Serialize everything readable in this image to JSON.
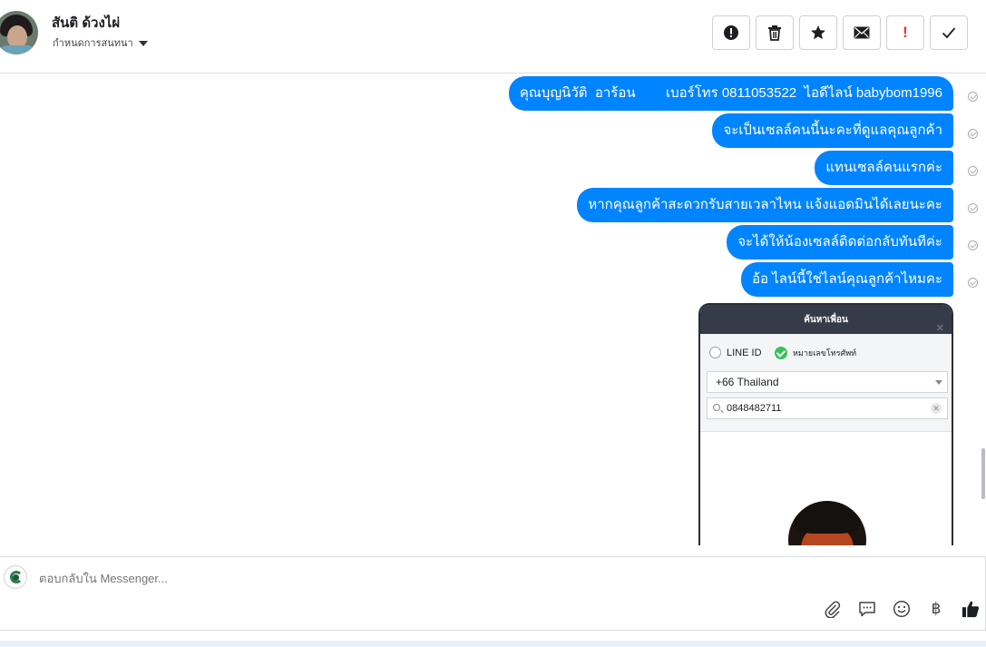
{
  "header": {
    "contact_name": "สันติ ด้วงไผ่",
    "assign_label": "กำหนดการสนทนา",
    "actions": [
      {
        "name": "spam-button",
        "icon": "alert-circle-icon"
      },
      {
        "name": "delete-button",
        "icon": "trash-icon"
      },
      {
        "name": "star-button",
        "icon": "star-icon"
      },
      {
        "name": "mark-unread-button",
        "icon": "envelope-icon"
      },
      {
        "name": "follow-up-button",
        "icon": "exclamation-icon",
        "label": "!"
      },
      {
        "name": "mark-done-button",
        "icon": "checkmark-icon"
      }
    ]
  },
  "messages": [
    {
      "text": "คุณบุญนิวัติ  อาร้อน        เบอร์โทร 0811053522  ไอดีไลน์ babybom1996"
    },
    {
      "text": "จะเป็นเซลล์คนนี้นะคะที่ดูแลคุณลูกค้า"
    },
    {
      "text": "แทนเซลล์คนแรกค่ะ"
    },
    {
      "text": "หากคุณลูกค้าสะดวกรับสายเวลาไหน แจ้งแอดมินได้เลยนะคะ"
    },
    {
      "text": "จะได้ให้น้องเซลล์ติดต่อกลับทันทีค่ะ"
    },
    {
      "text": "อ้อ ไลน์นี้ใช่ไลน์คุณลูกค้าไหมคะ"
    }
  ],
  "attachment": {
    "title": "ค้นหาเพื่อน",
    "close": "✕",
    "option_line_id": "LINE ID",
    "option_phone": "หมายเลขโทรศัพท์",
    "country": "+66  Thailand",
    "phone_query": "0848482711",
    "clear": "✕"
  },
  "composer": {
    "placeholder": "ตอบกลับใน Messenger...",
    "tools": [
      "paperclip-icon",
      "chat-bubble-icon",
      "smiley-icon",
      "baht-icon",
      "thumbs-up-icon"
    ],
    "baht_symbol": "฿"
  },
  "colors": {
    "bubble": "#0084ff",
    "bubble_text": "#ffffff",
    "border": "#dadde1",
    "phone_header": "#353b48",
    "radio_selected": "#3ac15a"
  }
}
